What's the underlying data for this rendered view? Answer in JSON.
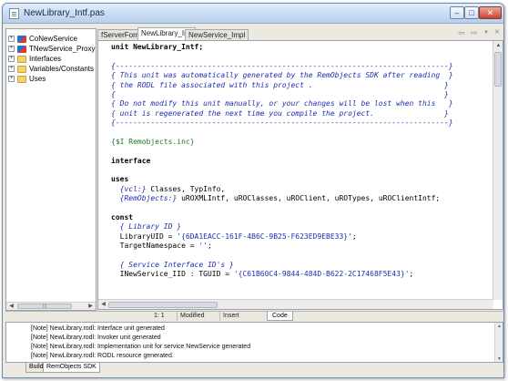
{
  "window": {
    "title": "NewLibrary_Intf.pas"
  },
  "tree": {
    "items": [
      {
        "label": "CoNewService",
        "icon": "component-icon",
        "expander": "+"
      },
      {
        "label": "TNewService_Proxy",
        "icon": "component-icon",
        "expander": "+"
      },
      {
        "label": "Interfaces",
        "icon": "folder-icon",
        "expander": "+"
      },
      {
        "label": "Variables/Constants",
        "icon": "folder-icon",
        "expander": "+"
      },
      {
        "label": "Uses",
        "icon": "folder-icon",
        "expander": "+"
      }
    ]
  },
  "tabs": [
    {
      "label": "fServerForm"
    },
    {
      "label": "NewLibrary_Intf"
    },
    {
      "label": "NewService_Impl"
    }
  ],
  "code_lines": [
    [
      {
        "t": "kw",
        "s": "unit NewLibrary_Intf;"
      }
    ],
    [],
    [
      {
        "t": "cm",
        "s": "{----------------------------------------------------------------------------}"
      }
    ],
    [
      {
        "t": "cm",
        "s": "{ This unit was automatically generated by the RemObjects SDK after reading  }"
      }
    ],
    [
      {
        "t": "cm",
        "s": "{ the RODL file associated with this project .                              }"
      }
    ],
    [
      {
        "t": "cm",
        "s": "{                                                                           }"
      }
    ],
    [
      {
        "t": "cm",
        "s": "{ Do not modify this unit manually, or your changes will be lost when this   }"
      }
    ],
    [
      {
        "t": "cm",
        "s": "{ unit is regenerated the next time you compile the project.                }"
      }
    ],
    [
      {
        "t": "cm",
        "s": "{----------------------------------------------------------------------------}"
      }
    ],
    [],
    [
      {
        "t": "dr",
        "s": "{$I Remobjects.inc}"
      }
    ],
    [],
    [
      {
        "t": "kw",
        "s": "interface"
      }
    ],
    [],
    [
      {
        "t": "kw",
        "s": "uses"
      }
    ],
    [
      {
        "t": "nr",
        "s": "  "
      },
      {
        "t": "cm",
        "s": "{vcl:}"
      },
      {
        "t": "nr",
        "s": " Classes, TypInfo,"
      }
    ],
    [
      {
        "t": "nr",
        "s": "  "
      },
      {
        "t": "cm",
        "s": "{RemObjects:}"
      },
      {
        "t": "nr",
        "s": " uROXMLIntf, uROClasses, uROClient, uROTypes, uROClientIntf;"
      }
    ],
    [],
    [
      {
        "t": "kw",
        "s": "const"
      }
    ],
    [
      {
        "t": "cm",
        "s": "  { Library ID }"
      }
    ],
    [
      {
        "t": "nr",
        "s": "  LibraryUID = "
      },
      {
        "t": "st",
        "s": "'{6DA1EACC-161F-4B6C-9B25-F623ED9EBE33}'"
      },
      {
        "t": "nr",
        "s": ";"
      }
    ],
    [
      {
        "t": "nr",
        "s": "  TargetNamespace = "
      },
      {
        "t": "st",
        "s": "''"
      },
      {
        "t": "nr",
        "s": ";"
      }
    ],
    [],
    [
      {
        "t": "cm",
        "s": "  { Service Interface ID's }"
      }
    ],
    [
      {
        "t": "nr",
        "s": "  INewService_IID : TGUID = "
      },
      {
        "t": "st",
        "s": "'{C61B60C4-9844-484D-B622-2C17468F5E43}'"
      },
      {
        "t": "nr",
        "s": ";"
      }
    ]
  ],
  "status": {
    "position": "1:  1",
    "state": "Modified",
    "mode": "Insert",
    "view_tab": "Code"
  },
  "messages": [
    "[Note] NewLibrary.rodl: Interface unit generated",
    "[Note] NewLibrary.rodl: Invoker unit generated",
    "[Note] NewLibrary.rodl: Implementation unit for service NewService generated",
    "[Note] NewLibrary.rodl: RODL resource generated."
  ],
  "bottom_tabs": [
    {
      "label": "Build"
    },
    {
      "label": "RemObjects SDK"
    }
  ]
}
